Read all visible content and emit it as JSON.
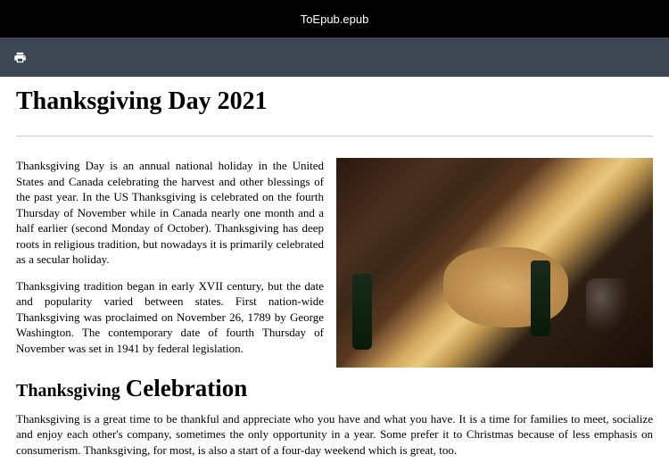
{
  "window": {
    "title": "ToEpub.epub"
  },
  "toolbar": {
    "print_icon": "print-icon"
  },
  "document": {
    "title": "Thanksgiving Day 2021",
    "para1": "Thanksgiving Day is an annual national holiday in the United States and Canada celebrating the harvest and other blessings of the past year. In the US Thanksgiving is celebrated on the fourth Thursday of November while in Canada nearly one month and a half earlier (second Monday of October). Thanksgiving has deep roots in religious tradition, but nowadays it is primarily celebrated as a secular holiday.",
    "para2": "Thanksgiving tradition began in early XVII century, but the date and popularity varied between states. First nation-wide Thanksgiving was proclaimed on November 26, 1789 by George Washington. The contemporary date of fourth Thursday of November was set in 1941 by federal legislation.",
    "subheading_word1": "Thanksgiving",
    "subheading_word2": "Celebration",
    "para3": "Thanksgiving is a great time to be thankful and appreciate who you have and what you have. It is a time for families to meet, socialize and enjoy each other's company, sometimes the only opportunity in a year. Some prefer it to Christmas because of less emphasis on consumerism. Thanksgiving, for most, is also a start of a four-day weekend which is great, too."
  }
}
